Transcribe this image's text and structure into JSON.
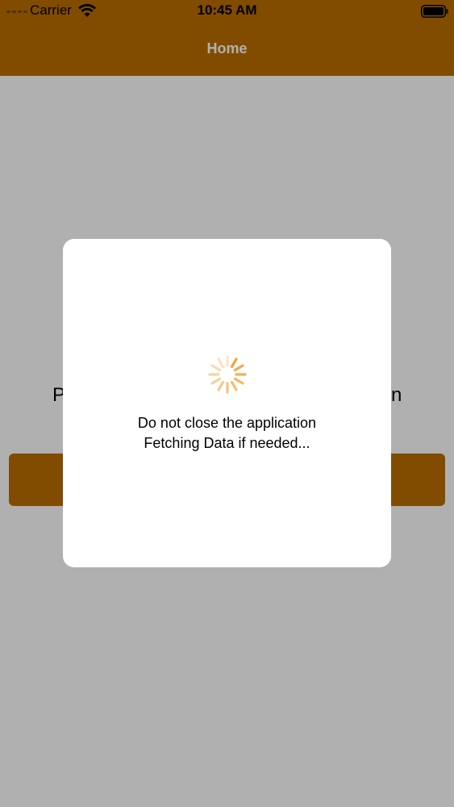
{
  "status_bar": {
    "carrier": "Carrier",
    "time": "10:45 AM",
    "icons": [
      "signal-icon",
      "wifi-icon",
      "battery-icon"
    ]
  },
  "nav": {
    "title": "Home",
    "color": "#BC6F00"
  },
  "background": {
    "prompt_left": "P",
    "prompt_right": "n",
    "button_color": "#BC6F00"
  },
  "dialog": {
    "line1": "Do not close the application",
    "line2": "Fetching Data if needed...",
    "spinner_color": "#F0A030"
  }
}
